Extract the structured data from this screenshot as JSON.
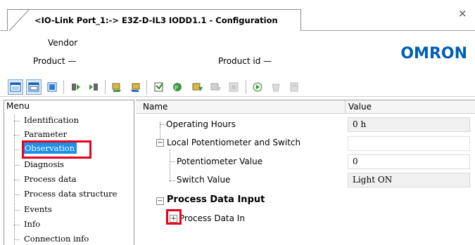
{
  "tab": {
    "title": "<IO-Link Port_1:-> E3Z-D-IL3 IODD1.1 - Configuration",
    "close_glyph": "×"
  },
  "header": {
    "vendor_label": "Vendor",
    "product_label": "Product —",
    "product_id_label": "Product id —",
    "logo_text": "OMRON",
    "logo_color": "#005eb8"
  },
  "toolbar": {
    "icons": [
      "layout-view-icon",
      "layout-split-icon",
      "layout-single-icon",
      "upload-icon",
      "download-icon",
      "read-device-icon",
      "write-device-icon",
      "compare-icon",
      "parameter-icon",
      "upload-param-icon",
      "download-param-icon",
      "device-disabled-icon",
      "online-icon",
      "disabled-icon-1",
      "disabled-icon-2"
    ]
  },
  "menu": {
    "header": "Menu",
    "items": [
      {
        "label": "Identification"
      },
      {
        "label": "Parameter"
      },
      {
        "label": "Observation"
      },
      {
        "label": "Diagnosis"
      },
      {
        "label": "Process data"
      },
      {
        "label": "Process data structure"
      },
      {
        "label": "Events"
      },
      {
        "label": "Info"
      },
      {
        "label": "Connection info"
      }
    ],
    "selected_index": 2,
    "selected_color": "#1e90e8",
    "highlight_color": "#e8001c"
  },
  "grid": {
    "col_name": "Name",
    "col_value": "Value",
    "rows": {
      "operating_hours": {
        "label": "Operating Hours",
        "value": "0 h"
      },
      "local_pot": {
        "label": "Local Potentiometer and Switch",
        "expander": "−"
      },
      "pot_value": {
        "label": "Potentiometer Value",
        "value": "0"
      },
      "switch_value": {
        "label": "Switch Value",
        "value": "Light ON"
      },
      "pdi": {
        "label": "Process Data Input",
        "expander": "−"
      },
      "pdin": {
        "label": "Process Data In",
        "expander": "+"
      }
    }
  }
}
